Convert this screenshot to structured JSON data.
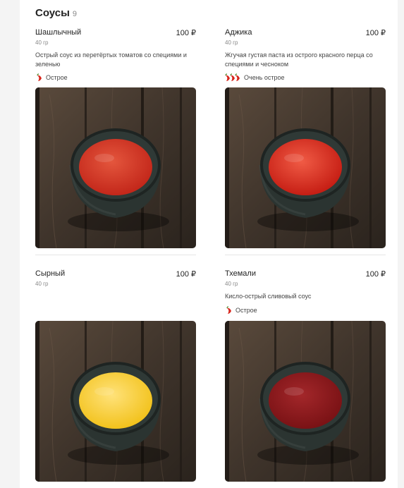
{
  "section": {
    "title": "Соусы",
    "count": "9"
  },
  "products": [
    {
      "name": "Шашлычный",
      "price": "100 ₽",
      "weight": "40 гр",
      "description": "Острый соус из перетёртых томатов со специями и зеленью",
      "spicy_label": "Острое",
      "spicy_level": 1,
      "sauce_color": "#c3271a",
      "sauce_highlight": "#e4563d"
    },
    {
      "name": "Аджика",
      "price": "100 ₽",
      "weight": "40 гр",
      "description": "Жгучая густая паста из острого красного перца со специями и чесноком",
      "spicy_label": "Очень острое",
      "spicy_level": 3,
      "sauce_color": "#c61e14",
      "sauce_highlight": "#f05b45"
    },
    {
      "name": "Сырный",
      "price": "100 ₽",
      "weight": "40 гр",
      "description": "",
      "spicy_label": "",
      "spicy_level": 0,
      "sauce_color": "#f2c21c",
      "sauce_highlight": "#ffe27a"
    },
    {
      "name": "Тхемали",
      "price": "100 ₽",
      "weight": "40 гр",
      "description": "Кисло-острый сливовый соус",
      "spicy_label": "Острое",
      "spicy_level": 1,
      "sauce_color": "#7a1215",
      "sauce_highlight": "#a3272a"
    }
  ]
}
